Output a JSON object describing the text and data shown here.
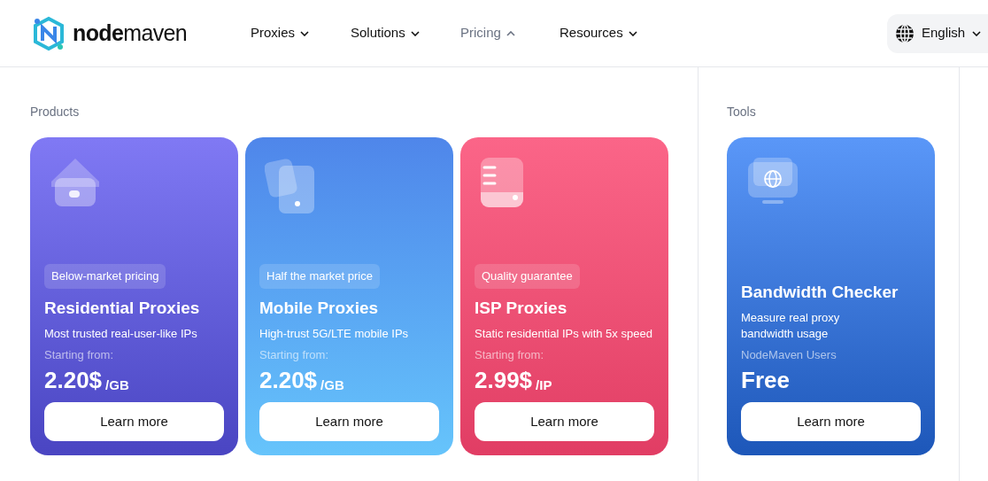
{
  "header": {
    "logo": {
      "bold": "node",
      "light": "maven"
    },
    "nav": [
      {
        "label": "Proxies",
        "expanded": false
      },
      {
        "label": "Solutions",
        "expanded": false
      },
      {
        "label": "Pricing",
        "expanded": true
      },
      {
        "label": "Resources",
        "expanded": false
      }
    ],
    "language": "English"
  },
  "sections": [
    {
      "title": "Products",
      "cards": [
        {
          "badge": "Below-market pricing",
          "title": "Residential Proxies",
          "description": "Most trusted real-user-like IPs",
          "price_label": "Starting from:",
          "price": "2.20$",
          "unit": "/GB",
          "button": "Learn more"
        },
        {
          "badge": "Half the market price",
          "title": "Mobile Proxies",
          "description": "High-trust 5G/LTE mobile IPs",
          "price_label": "Starting from:",
          "price": "2.20$",
          "unit": "/GB",
          "button": "Learn more"
        },
        {
          "badge": "Quality guarantee",
          "title": "ISP Proxies",
          "description": "Static residential IPs with 5x speed",
          "price_label": "Starting from:",
          "price": "2.99$",
          "unit": "/IP",
          "button": "Learn more"
        }
      ]
    },
    {
      "title": "Tools",
      "cards": [
        {
          "title": "Bandwidth Checker",
          "description": "Measure real proxy bandwidth usage",
          "price_label": "NodeMaven Users",
          "price": "Free",
          "button": "Learn more"
        }
      ]
    }
  ]
}
